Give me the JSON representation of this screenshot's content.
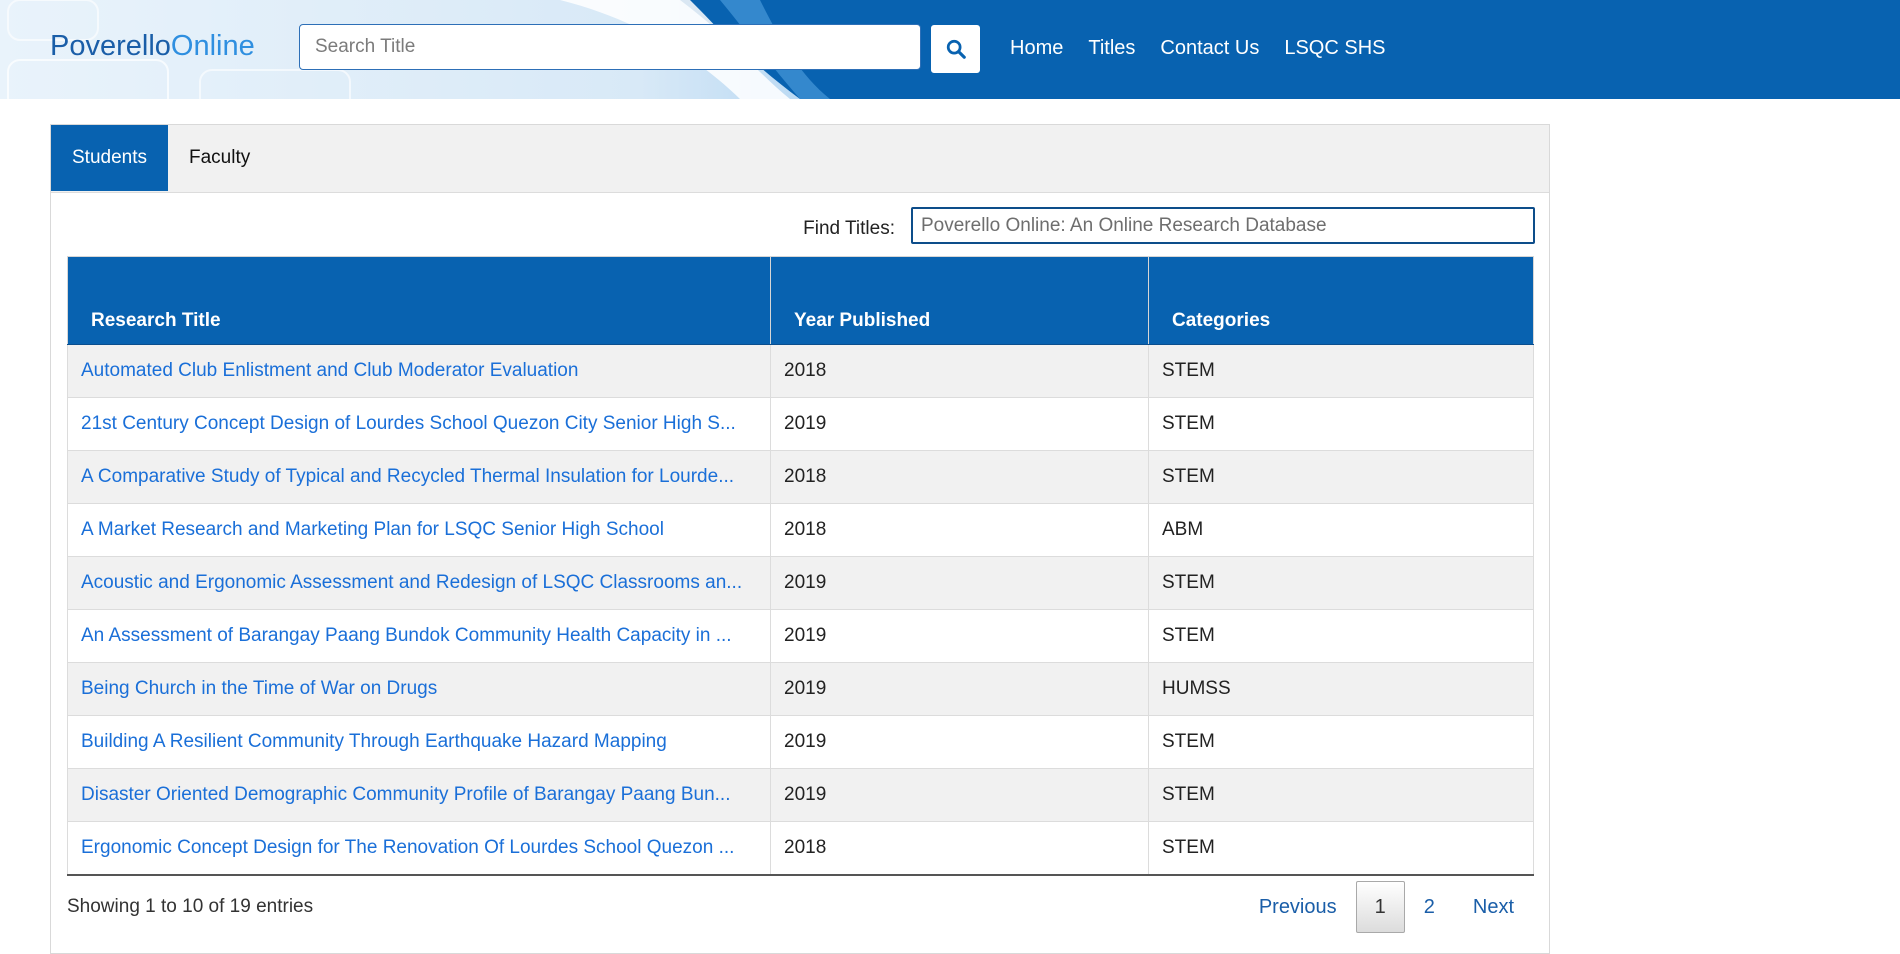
{
  "header": {
    "brand_prefix": "Poverello",
    "brand_suffix": "Online",
    "search_placeholder": "Search Title",
    "nav": [
      "Home",
      "Titles",
      "Contact Us",
      "LSQC SHS"
    ]
  },
  "tabs": [
    {
      "label": "Students",
      "active": true
    },
    {
      "label": "Faculty",
      "active": false
    }
  ],
  "filter": {
    "label": "Find Titles:",
    "placeholder": "Poverello Online: An Online Research Database"
  },
  "table": {
    "columns": [
      "Research Title",
      "Year Published",
      "Categories"
    ],
    "rows": [
      {
        "title": "Automated Club Enlistment and Club Moderator Evaluation",
        "year": "2018",
        "category": "STEM"
      },
      {
        "title": "21st Century Concept Design of Lourdes School Quezon City Senior High S...",
        "year": "2019",
        "category": "STEM"
      },
      {
        "title": "A Comparative Study of Typical and Recycled Thermal Insulation for Lourde...",
        "year": "2018",
        "category": "STEM"
      },
      {
        "title": "A Market Research and Marketing Plan for LSQC Senior High School",
        "year": "2018",
        "category": "ABM"
      },
      {
        "title": "Acoustic and Ergonomic Assessment and Redesign of LSQC Classrooms an...",
        "year": "2019",
        "category": "STEM"
      },
      {
        "title": "An Assessment of Barangay Paang Bundok Community Health Capacity in ...",
        "year": "2019",
        "category": "STEM"
      },
      {
        "title": "Being Church in the Time of War on Drugs",
        "year": "2019",
        "category": "HUMSS"
      },
      {
        "title": "Building A Resilient Community Through Earthquake Hazard Mapping",
        "year": "2019",
        "category": "STEM"
      },
      {
        "title": "Disaster Oriented Demographic Community Profile of Barangay Paang Bun...",
        "year": "2019",
        "category": "STEM"
      },
      {
        "title": "Ergonomic Concept Design for The Renovation Of Lourdes School Quezon ...",
        "year": "2018",
        "category": "STEM"
      }
    ]
  },
  "footer": {
    "info": "Showing 1 to 10 of 19 entries",
    "pagination": {
      "previous": "Previous",
      "pages": [
        "1",
        "2"
      ],
      "current": "1",
      "next": "Next"
    }
  },
  "colors": {
    "primary": "#0862b0",
    "link": "#1a6fd8",
    "row_alt": "#f1f1f1"
  },
  "icons": {
    "search": "search-icon"
  }
}
